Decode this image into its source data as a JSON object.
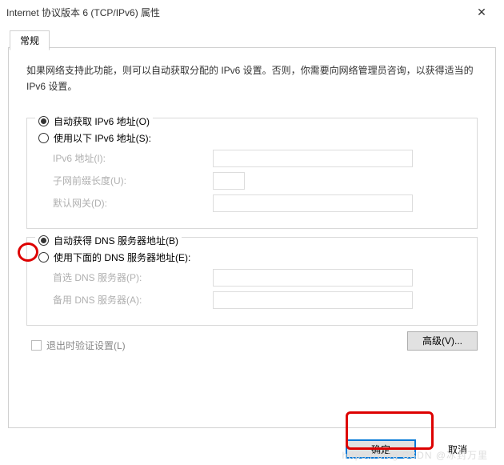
{
  "window": {
    "title": "Internet 协议版本 6 (TCP/IPv6) 属性",
    "close": "✕"
  },
  "tab": {
    "general": "常规"
  },
  "intro": "如果网络支持此功能，则可以自动获取分配的 IPv6 设置。否则，你需要向网络管理员咨询，以获得适当的 IPv6 设置。",
  "ip": {
    "auto": "自动获取 IPv6 地址(O)",
    "manual": "使用以下 IPv6 地址(S):",
    "addr": "IPv6 地址(I):",
    "prefix": "子网前缀长度(U):",
    "gateway": "默认网关(D):"
  },
  "dns": {
    "auto": "自动获得 DNS 服务器地址(B)",
    "manual": "使用下面的 DNS 服务器地址(E):",
    "preferred": "首选 DNS 服务器(P):",
    "alternate": "备用 DNS 服务器(A):"
  },
  "validate": "退出时验证设置(L)",
  "buttons": {
    "advanced": "高级(V)...",
    "ok": "确定",
    "cancel": "取消"
  },
  "watermark": "https://blog CSDN @冰封万里"
}
